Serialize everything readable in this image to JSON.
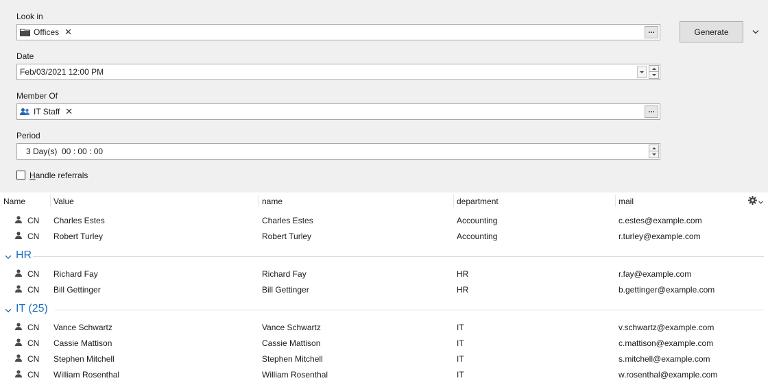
{
  "form": {
    "look_in": {
      "label": "Look in",
      "tag": "Offices",
      "tag_icon": "folder-icon",
      "browse_label": "...",
      "remove_label": "✕"
    },
    "date": {
      "label": "Date",
      "value": "Feb/03/2021 12:00 PM"
    },
    "member_of": {
      "label": "Member Of",
      "tag": "IT Staff",
      "tag_icon": "group-icon",
      "browse_label": "...",
      "remove_label": "✕"
    },
    "period": {
      "label": "Period",
      "value": "3 Day(s)  00 : 00 : 00"
    },
    "handle_referrals": {
      "label_accel": "H",
      "label_rest": "andle referrals",
      "checked": false
    },
    "generate_label": "Generate"
  },
  "grid": {
    "columns": [
      "Name",
      "Value",
      "name",
      "department",
      "mail"
    ],
    "row_type_label": "CN",
    "groups": [
      {
        "title": "",
        "rows": [
          {
            "value": "Charles Estes",
            "name": "Charles Estes",
            "department": "Accounting",
            "mail": "c.estes@example.com"
          },
          {
            "value": "Robert Turley",
            "name": "Robert Turley",
            "department": "Accounting",
            "mail": "r.turley@example.com"
          }
        ]
      },
      {
        "title": "HR",
        "rows": [
          {
            "value": "Richard Fay",
            "name": "Richard Fay",
            "department": "HR",
            "mail": "r.fay@example.com"
          },
          {
            "value": "Bill Gettinger",
            "name": "Bill Gettinger",
            "department": "HR",
            "mail": "b.gettinger@example.com"
          }
        ]
      },
      {
        "title": "IT (25)",
        "rows": [
          {
            "value": "Vance Schwartz",
            "name": "Vance Schwartz",
            "department": "IT",
            "mail": "v.schwartz@example.com"
          },
          {
            "value": "Cassie Mattison",
            "name": "Cassie Mattison",
            "department": "IT",
            "mail": "c.mattison@example.com"
          },
          {
            "value": "Stephen Mitchell",
            "name": "Stephen Mitchell",
            "department": "IT",
            "mail": "s.mitchell@example.com"
          },
          {
            "value": "William Rosenthal",
            "name": "William Rosenthal",
            "department": "IT",
            "mail": "w.rosenthal@example.com"
          }
        ]
      }
    ]
  },
  "colors": {
    "form_background": "#f0f0f0",
    "group_title": "#1e6fc2"
  }
}
